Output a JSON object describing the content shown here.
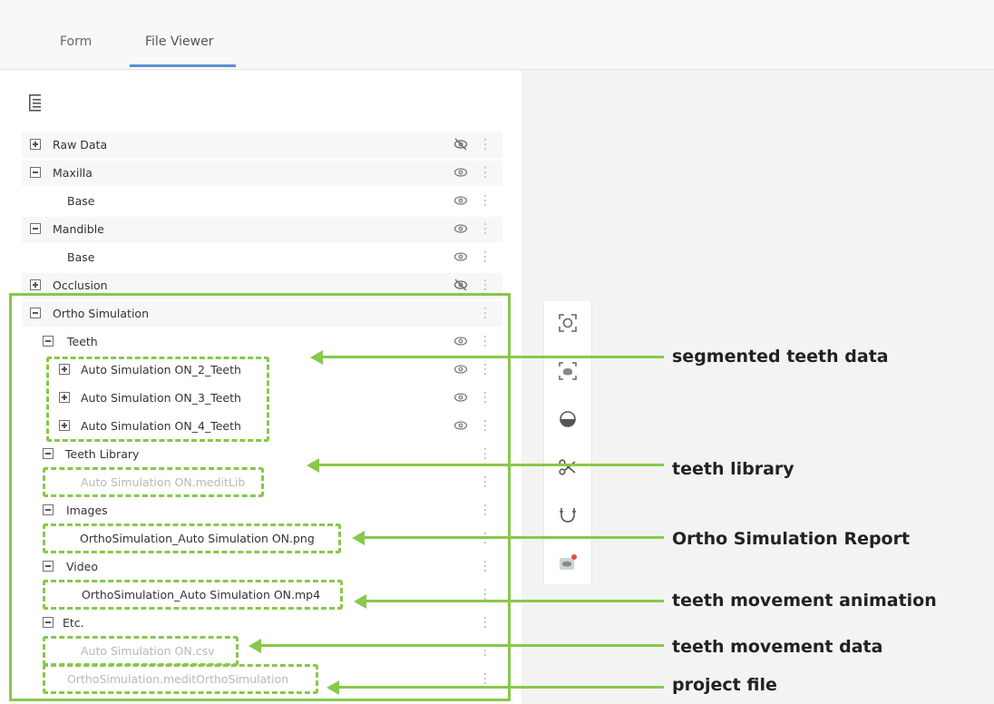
{
  "tabs": {
    "form": "Form",
    "file_viewer": "File Viewer"
  },
  "tree": {
    "raw_data": "Raw Data",
    "maxilla": "Maxilla",
    "maxilla_base": "Base",
    "mandible": "Mandible",
    "mandible_base": "Base",
    "occlusion": "Occlusion",
    "ortho_simulation": "Ortho Simulation",
    "teeth": "Teeth",
    "teeth_items": [
      "Auto Simulation ON_2_Teeth",
      "Auto Simulation ON_3_Teeth",
      "Auto Simulation ON_4_Teeth"
    ],
    "teeth_library": "Teeth Library",
    "teeth_library_file": "Auto Simulation ON.meditLib",
    "images": "Images",
    "images_file": "OrthoSimulation_Auto Simulation ON.png",
    "video": "Video",
    "video_file": "OrthoSimulation_Auto Simulation ON.mp4",
    "etc": "Etc.",
    "etc_csv": "Auto Simulation ON.csv",
    "etc_project": "OrthoSimulation.meditOrthoSimulation"
  },
  "annotations": {
    "segmented": "segmented teeth data",
    "library": "teeth library",
    "report": "Ortho Simulation Report",
    "animation": "teeth movement animation",
    "movement_data": "teeth movement data",
    "project": "project file"
  },
  "colors": {
    "accent": "#5b8fd1",
    "annotation_green": "#88c84a"
  }
}
